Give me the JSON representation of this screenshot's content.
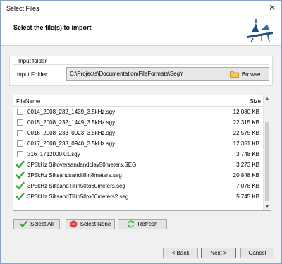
{
  "window": {
    "title": "Select Files",
    "close_glyph": "✕"
  },
  "header": {
    "title": "Select the file(s) to import",
    "logo_icon": "seismic-platform-logo"
  },
  "input_folder": {
    "group_title": "Input folder",
    "label": "Input Folder:",
    "path": "C:\\Projects\\Documentation\\FileFormats\\SegY",
    "browse_label": "Browse..."
  },
  "file_list": {
    "columns": {
      "name": "FileName",
      "size": "Size"
    },
    "rows": [
      {
        "name": "0014_2008_232_1439_3.5kHz.sgy",
        "size": "12,080 KB",
        "checked": false
      },
      {
        "name": "0015_2008_232_1449_3.5kHz.sgy",
        "size": "22,315 KB",
        "checked": false
      },
      {
        "name": "0016_2008_233_0923_3.5kHz.sgy",
        "size": "22,575 KB",
        "checked": false
      },
      {
        "name": "0017_2008_233_0940_3.5kHz.sgy",
        "size": "12,351 KB",
        "checked": false
      },
      {
        "name": "316_1712000.01.sgy",
        "size": "3,748 KB",
        "checked": false
      },
      {
        "name": "3P5kHz Siltoversandandclay50meters.SEG",
        "size": "3,273 KB",
        "checked": true
      },
      {
        "name": "3P5kHz Siltsandsandtillin8meters.seg",
        "size": "20,848 KB",
        "checked": true
      },
      {
        "name": "3P5kHz SiltsandTillin50to60meters.seg",
        "size": "7,078 KB",
        "checked": true
      },
      {
        "name": "3P5kHz SiltsandTillin50to60meters2.seg",
        "size": "5,745 KB",
        "checked": true
      }
    ]
  },
  "actions": {
    "select_all": "Select All",
    "select_none": "Select None",
    "refresh": "Refresh"
  },
  "nav": {
    "back": "< Back",
    "next": "Next >",
    "cancel": "Cancel"
  },
  "colors": {
    "check_green": "#3aa83a",
    "select_none_red": "#d04040",
    "refresh_green": "#4caf50",
    "accent_border": "#3c7fb1"
  }
}
